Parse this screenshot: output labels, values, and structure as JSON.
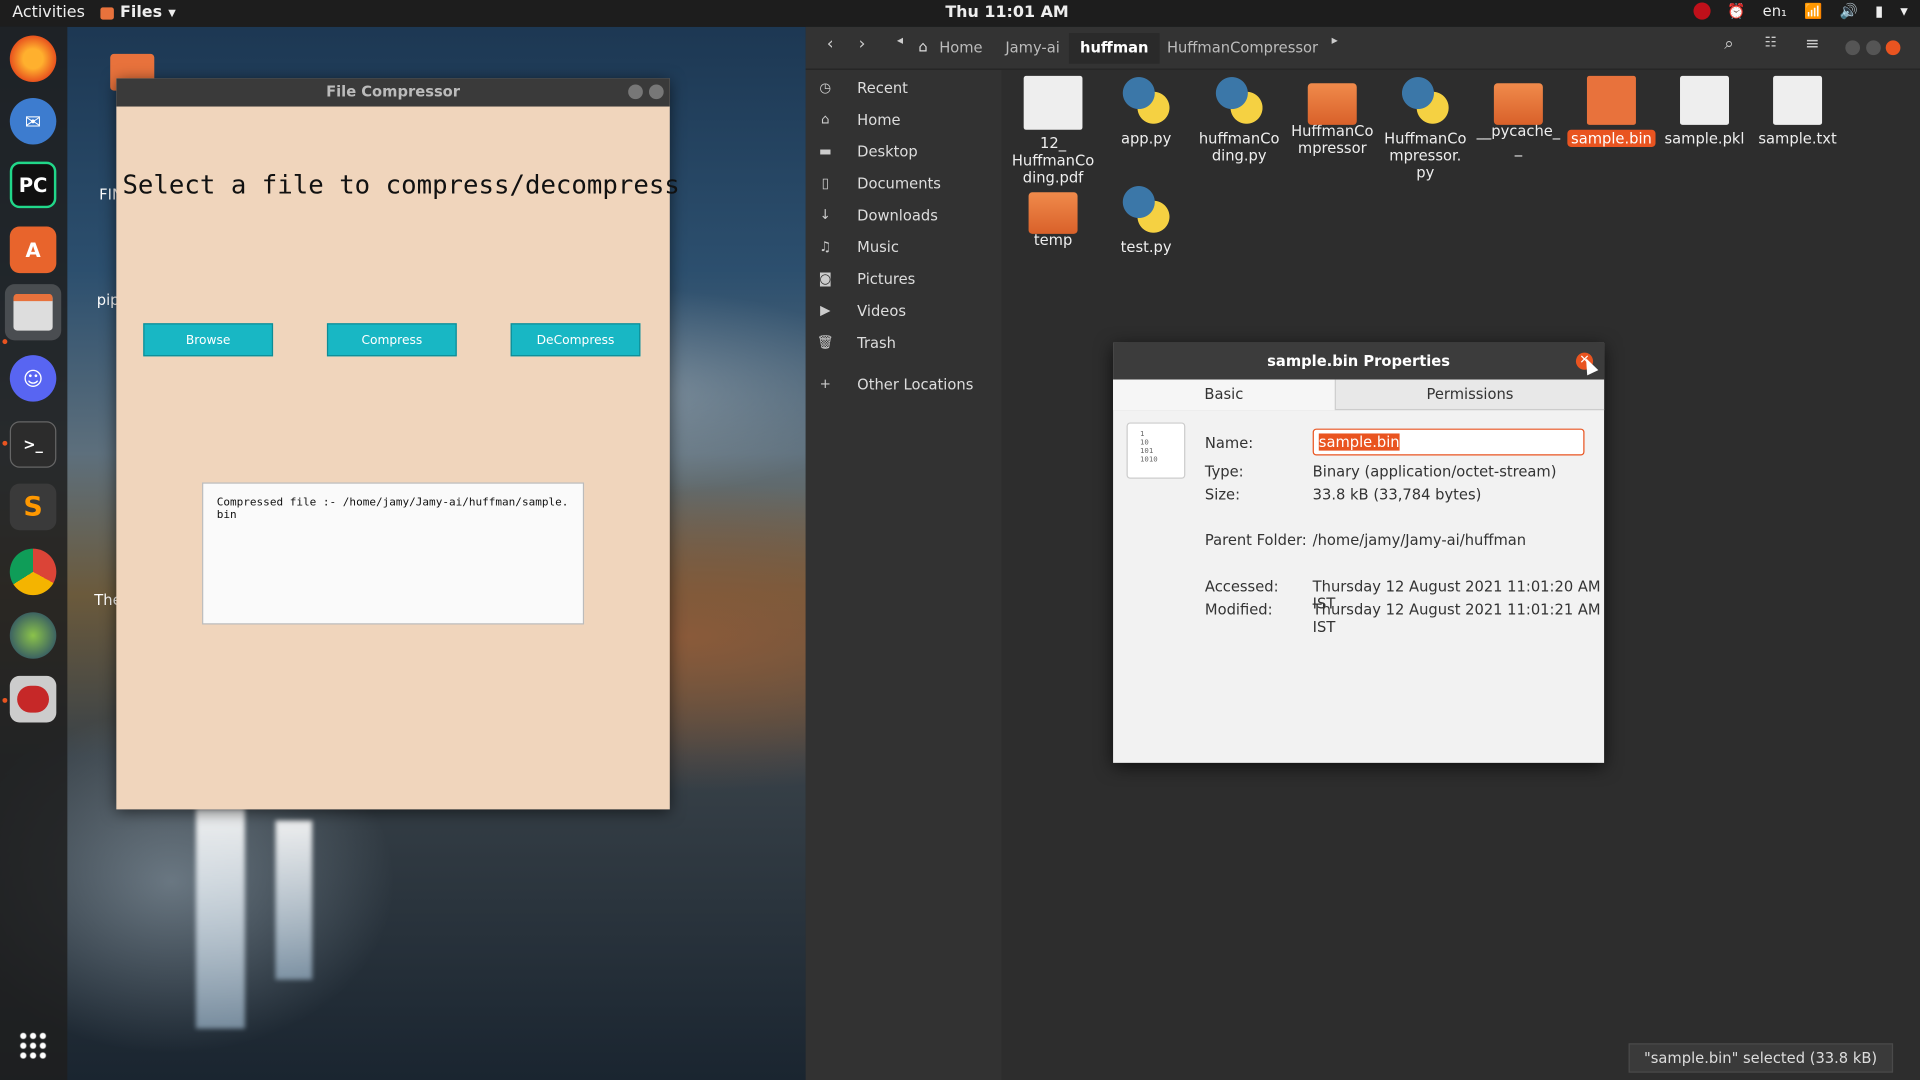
{
  "topbar": {
    "activities": "Activities",
    "app_menu": "Files",
    "clock": "Thu 11:01 AM",
    "lang": "en₁"
  },
  "desktop": {
    "labels": [
      "FIN",
      "pip",
      "The"
    ]
  },
  "compressor": {
    "title": "File Compressor",
    "heading": "Select a file to compress/decompress",
    "browse": "Browse",
    "compress": "Compress",
    "decompress": "DeCompress",
    "output": "Compressed file :- /home/jamy/Jamy-ai/huffman/sample.bin"
  },
  "filemanager": {
    "breadcrumbs": [
      "Home",
      "Jamy-ai",
      "huffman",
      "HuffmanCompressor"
    ],
    "sidebar": [
      "Recent",
      "Home",
      "Desktop",
      "Documents",
      "Downloads",
      "Music",
      "Pictures",
      "Videos",
      "Trash",
      "Other Locations"
    ],
    "files": [
      {
        "name": "12_\nHuffmanCo\nding.pdf",
        "kind": "doc"
      },
      {
        "name": "app.py",
        "kind": "py"
      },
      {
        "name": "huffmanCo\nding.py",
        "kind": "py"
      },
      {
        "name": "HuffmanCo\nmpressor",
        "kind": "folder"
      },
      {
        "name": "HuffmanCo\nmpressor.\npy",
        "kind": "py"
      },
      {
        "name": "__pycache_\n_",
        "kind": "folder"
      },
      {
        "name": "sample.bin",
        "kind": "bin"
      },
      {
        "name": "sample.pkl",
        "kind": "doc"
      },
      {
        "name": "sample.txt",
        "kind": "doc"
      },
      {
        "name": "temp",
        "kind": "folder"
      },
      {
        "name": "test.py",
        "kind": "py"
      }
    ],
    "status": "\"sample.bin\" selected  (33.8 kB)"
  },
  "properties": {
    "title": "sample.bin Properties",
    "tabs": [
      "Basic",
      "Permissions"
    ],
    "name_label": "Name:",
    "name_value": "sample.bin",
    "type_label": "Type:",
    "type_value": "Binary (application/octet-stream)",
    "size_label": "Size:",
    "size_value": "33.8 kB (33,784 bytes)",
    "parent_label": "Parent Folder:",
    "parent_value": "/home/jamy/Jamy-ai/huffman",
    "accessed_label": "Accessed:",
    "accessed_value": "Thursday 12 August 2021 11:01:20 AM IST",
    "modified_label": "Modified:",
    "modified_value": "Thursday 12 August 2021 11:01:21 AM IST",
    "icon_text": "1\n10\n101\n1010"
  },
  "colors": {
    "accent": "#e95420",
    "button": "#18b7c4",
    "compressor_bg": "#f0d5bc"
  }
}
